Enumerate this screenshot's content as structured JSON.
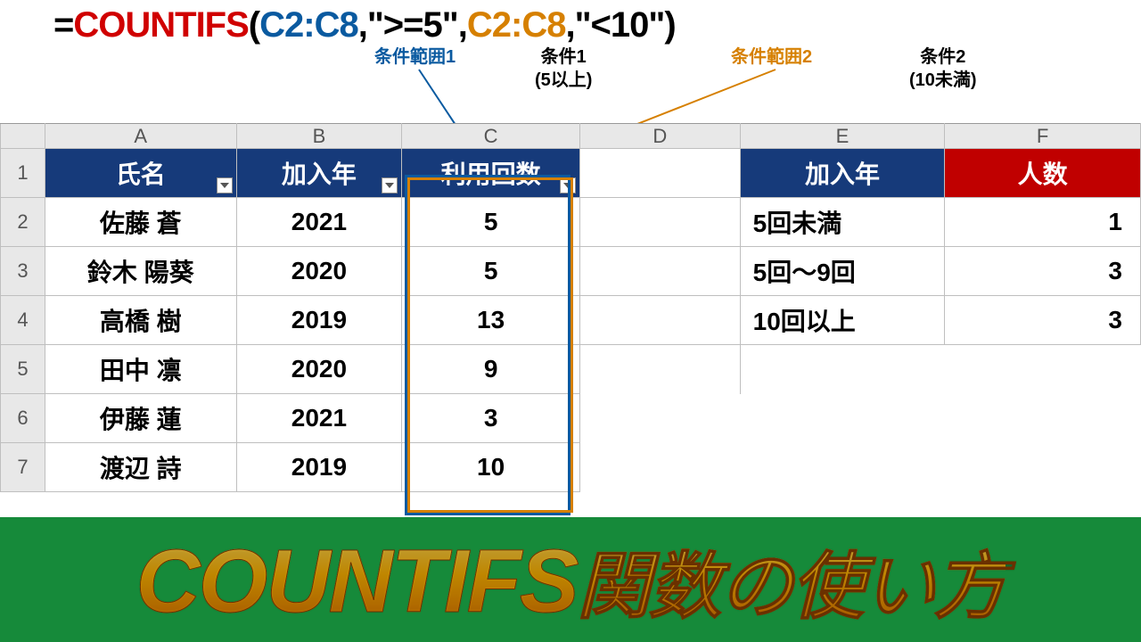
{
  "formula": {
    "parts": [
      "=",
      "COUNTIFS",
      "(",
      "C2:C8",
      ",",
      "\">=5\"",
      ",",
      "C2:C8",
      ",",
      "\"<10\"",
      ")"
    ]
  },
  "annotations": {
    "r1": "条件範囲1",
    "c1a": "条件1",
    "c1b": "(5以上)",
    "r2": "条件範囲2",
    "c2a": "条件2",
    "c2b": "(10未満)"
  },
  "columns": [
    "A",
    "B",
    "C",
    "D",
    "E",
    "F"
  ],
  "rows": [
    "1",
    "2",
    "3",
    "4",
    "5",
    "6",
    "7"
  ],
  "main": {
    "headers": [
      "氏名",
      "加入年",
      "利用回数"
    ],
    "data": [
      [
        "佐藤 蒼",
        "2021",
        "5"
      ],
      [
        "鈴木 陽葵",
        "2020",
        "5"
      ],
      [
        "高橋 樹",
        "2019",
        "13"
      ],
      [
        "田中 凛",
        "2020",
        "9"
      ],
      [
        "伊藤 蓮",
        "2021",
        "3"
      ],
      [
        "渡辺 詩",
        "2019",
        "10"
      ]
    ]
  },
  "summary": {
    "headers": [
      "加入年",
      "人数"
    ],
    "data": [
      [
        "5回未満",
        "1"
      ],
      [
        "5回〜9回",
        "3"
      ],
      [
        "10回以上",
        "3"
      ]
    ]
  },
  "banner": {
    "big": "COUNTIFS",
    "rest": "関数の使い方"
  }
}
